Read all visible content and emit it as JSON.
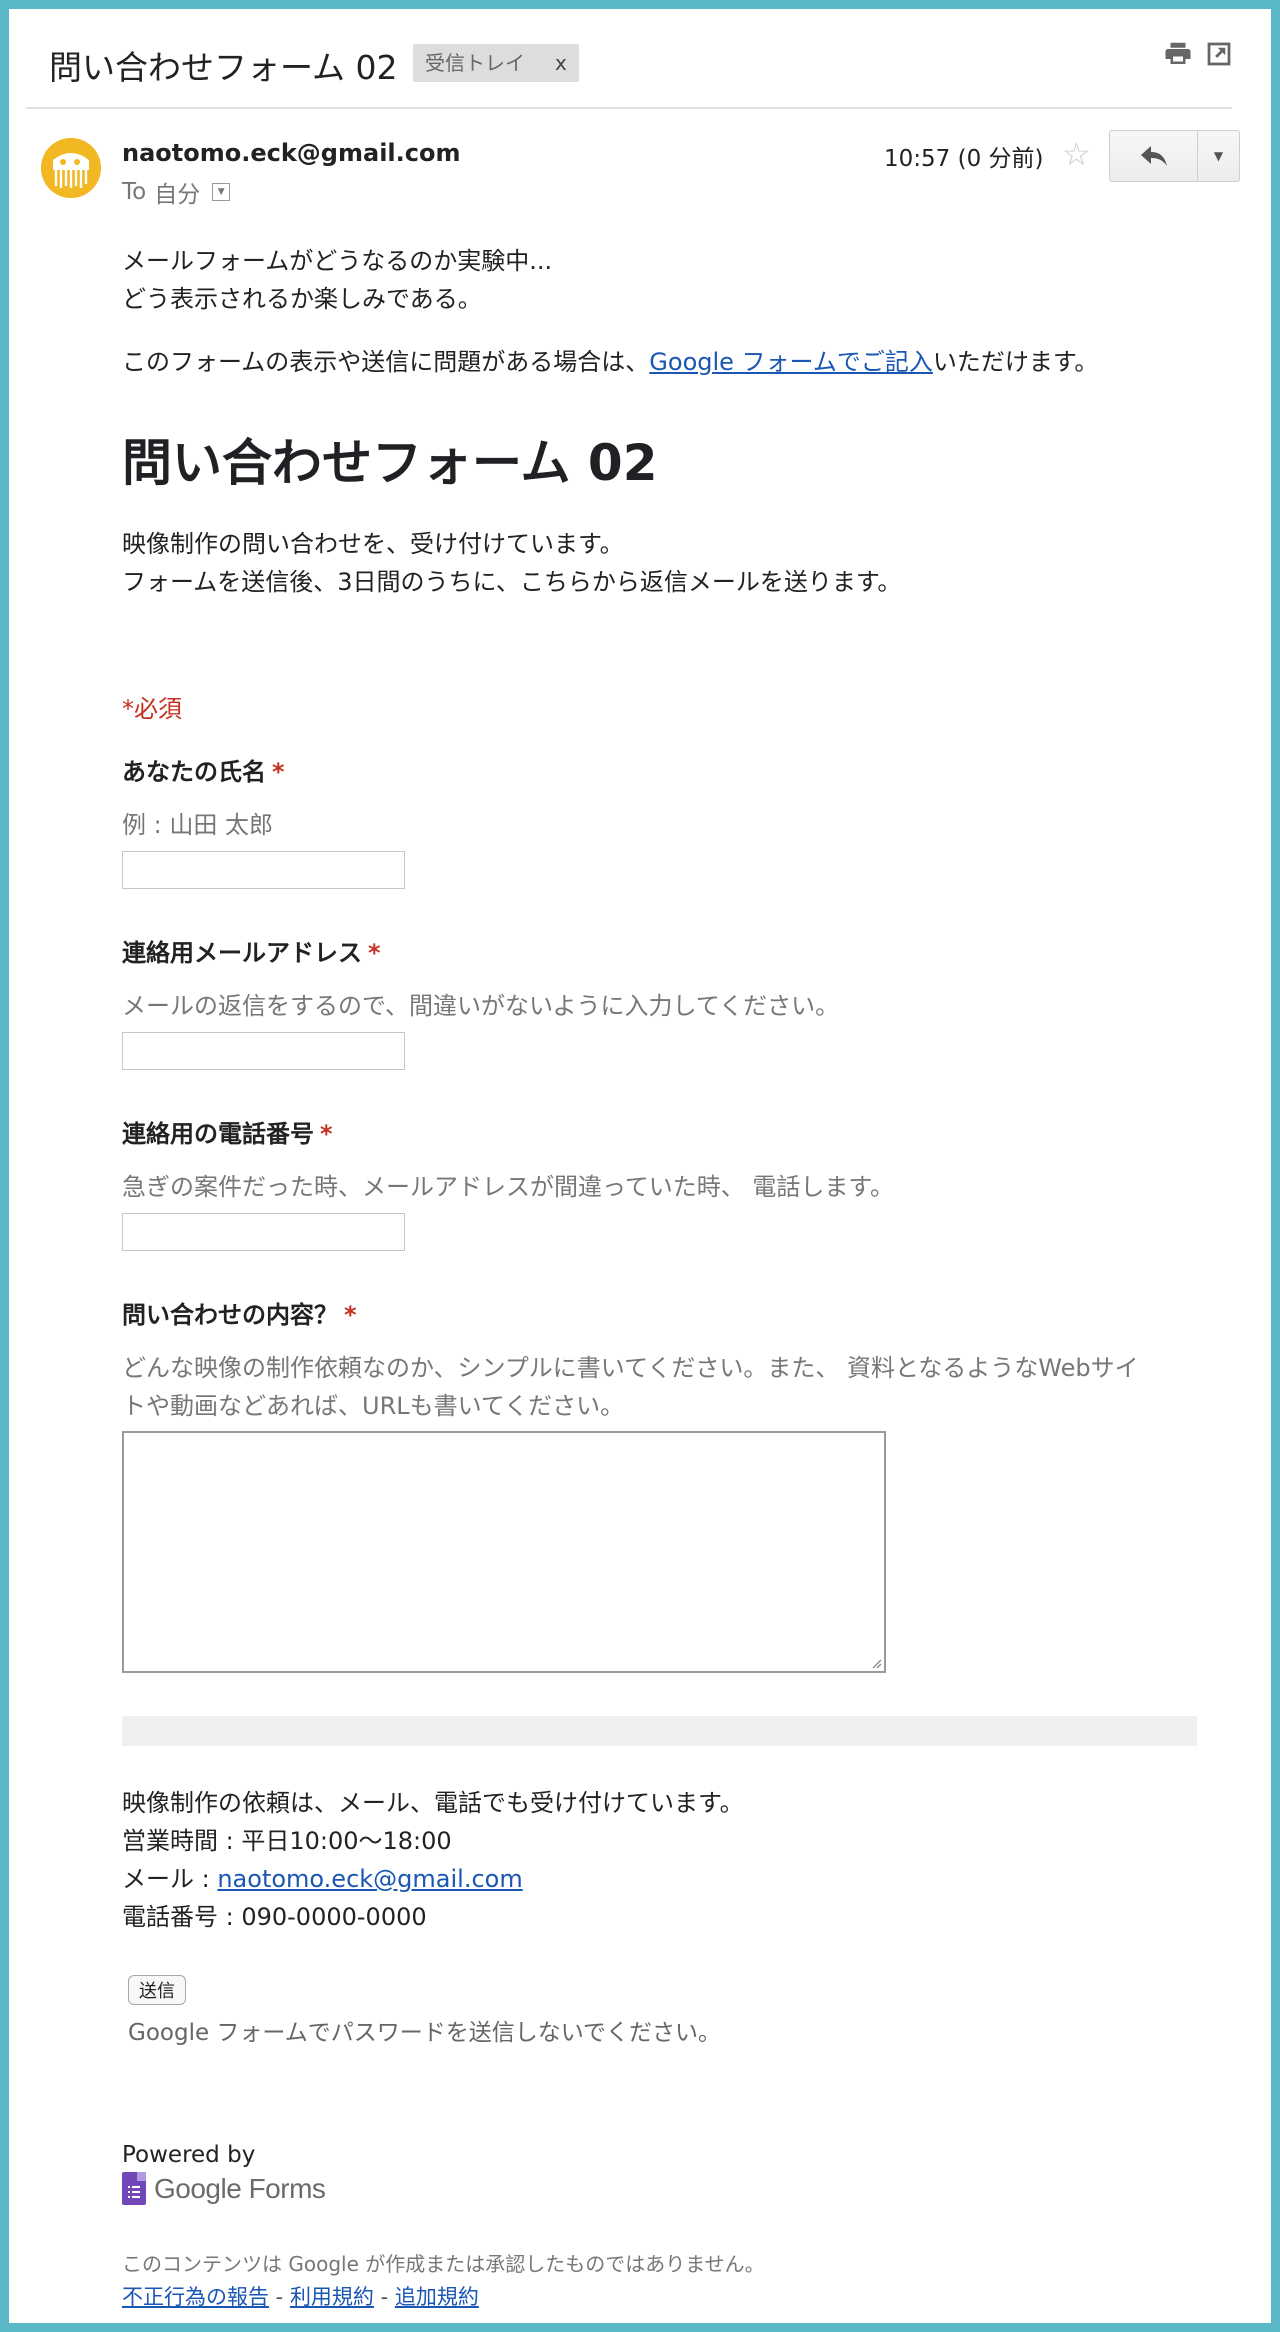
{
  "header": {
    "subject": "問い合わせフォーム 02",
    "label": "受信トレイ",
    "label_remove": "x",
    "icons": [
      "print-icon",
      "open-in-new-window-icon"
    ]
  },
  "message": {
    "sender": "naotomo.eck@gmail.com",
    "to_prefix": "To",
    "to_value": "自分",
    "time": "10:57 (0 分前)",
    "star_glyph": "☆"
  },
  "body": {
    "intro_line1": "メールフォームがどうなるのか実験中...",
    "intro_line2": "どう表示されるか楽しみである。",
    "notice_prefix": "このフォームの表示や送信に問題がある場合は、",
    "notice_link": "Google フォームでご記入",
    "notice_suffix": "いただけます。"
  },
  "form": {
    "title": "問い合わせフォーム 02",
    "desc_line1": "映像制作の問い合わせを、受け付けています。",
    "desc_line2": "フォームを送信後、3日間のうちに、こちらから返信メールを送ります。",
    "required_note": "*必須",
    "required_mark": "*",
    "questions": [
      {
        "label": "あなたの氏名",
        "help": "例 : 山田 太郎"
      },
      {
        "label": "連絡用メールアドレス",
        "help": "メールの返信をするので、間違いがないように入力してください。"
      },
      {
        "label": "連絡用の電話番号",
        "help": "急ぎの案件だった時、メールアドレスが間違っていた時、 電話します。"
      },
      {
        "label": "問い合わせの内容？",
        "help_line1": "どんな映像の制作依頼なのか、シンプルに書いてください。また、 資料となるようなWebサイ",
        "help_line2": "トや動画などあれば、URLも書いてください。"
      }
    ],
    "contact_line1": "映像制作の依頼は、メール、電話でも受け付けています。",
    "contact_line2": "営業時間 : 平日10:00〜18:00",
    "contact_mail_prefix": "メール : ",
    "contact_mail": "naotomo.eck@gmail.com",
    "contact_phone": "電話番号 : 090-0000-0000",
    "submit_label": "送信",
    "password_warning": "Google フォームでパスワードを送信しないでください。"
  },
  "footer": {
    "powered_by": "Powered by",
    "brand": "Google Forms",
    "disclaimer": "このコンテンツは Google が作成または承認したものではありません。",
    "link_abuse": "不正行為の報告",
    "link_terms": "利用規約",
    "link_additional": "追加規約",
    "separator": " - "
  },
  "colors": {
    "frame": "#5bb8c8",
    "link": "#1a56b3",
    "required": "#c5301f",
    "avatar": "#f2b824",
    "forms_purple": "#7248b9"
  }
}
